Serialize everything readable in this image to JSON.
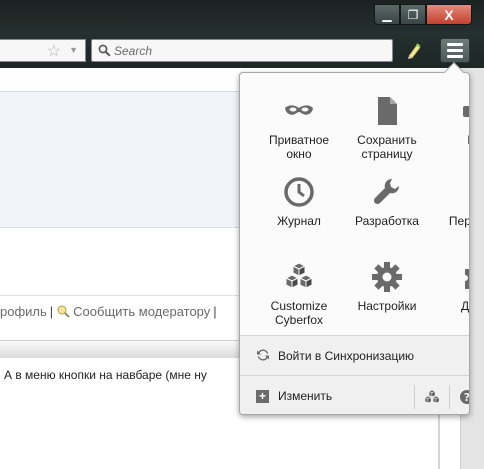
{
  "window": {
    "minimize": "▁",
    "maximize": "❐",
    "close": "X"
  },
  "toolbar": {
    "search_placeholder": "Search",
    "icons": [
      "star-icon",
      "search-icon",
      "pencil-icon",
      "hamburger-menu-icon"
    ]
  },
  "page": {
    "link_profile": "рофиль",
    "link_report": "Сообщить модератору",
    "separator": "|",
    "post_text": "А в меню кнопки на навбаре (мне ну"
  },
  "panel": {
    "items": [
      {
        "label": "Приватное окно",
        "icon": "mask-icon"
      },
      {
        "label": "Сохранить страницу",
        "icon": "page-icon"
      },
      {
        "label": "Пе",
        "icon": "print-icon"
      },
      {
        "label": "Журнал",
        "icon": "clock-icon"
      },
      {
        "label": "Разработка",
        "icon": "wrench-icon"
      },
      {
        "label": "Пере бра",
        "icon": "new-window-icon"
      },
      {
        "label": "Customize Cyberfox",
        "icon": "cubes-icon"
      },
      {
        "label": "Настройки",
        "icon": "gear-icon"
      },
      {
        "label": "Допо",
        "icon": "puzzle-icon"
      }
    ],
    "sync_label": "Войти в Синхронизацию",
    "customize_label": "Изменить"
  },
  "colors": {
    "icon_gray": "#6a6a6a",
    "accent_green": "#5a9e2a",
    "close_red": "#c4402e",
    "toolbar_dark": "#1c2625"
  }
}
